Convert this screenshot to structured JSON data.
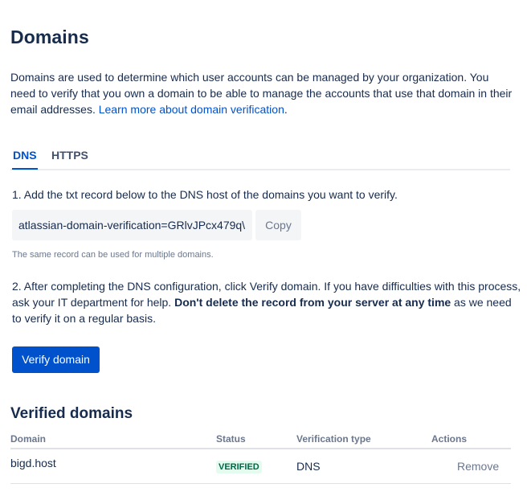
{
  "page": {
    "title": "Domains",
    "intro_text": "Domains are used to determine which user accounts can be managed by your organization. You need to verify that you own a domain to be able to manage the accounts that use that domain in their email addresses.",
    "intro_link": "Learn more about domain verification",
    "intro_suffix": "."
  },
  "tabs": [
    {
      "label": "DNS",
      "active": true
    },
    {
      "label": "HTTPS",
      "active": false
    }
  ],
  "dns": {
    "step1": "1. Add the txt record below to the DNS host of the domains you want to verify.",
    "record_value": "atlassian-domain-verification=GRlvJPcx479q\\",
    "copy_label": "Copy",
    "helper": "The same record can be used for multiple domains.",
    "step2_prefix": "2. After completing the DNS configuration, click Verify domain. If you have difficulties with this process, ask your IT department for help. ",
    "step2_bold": "Don't delete the record from your server at any time",
    "step2_suffix": " as we need to verify it on a regular basis.",
    "verify_label": "Verify domain"
  },
  "verified": {
    "title": "Verified domains",
    "columns": [
      "Domain",
      "Status",
      "Verification type",
      "Actions"
    ],
    "rows": [
      {
        "domain": "bigd.host",
        "status": "VERIFIED",
        "type": "DNS",
        "action": "Remove"
      }
    ]
  },
  "colors": {
    "primary": "#0052cc",
    "text": "#172b4d",
    "subtle": "#6b778c",
    "success_bg": "#e3fcef",
    "success_text": "#006644"
  }
}
